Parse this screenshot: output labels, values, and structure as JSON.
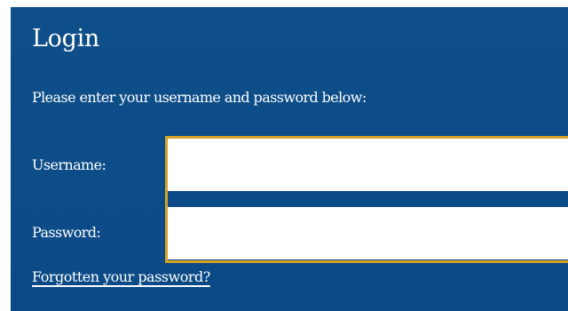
{
  "login": {
    "title": "Login",
    "instructions": "Please enter your username and password below:",
    "username_label": "Username:",
    "password_label": "Password:",
    "username_value": "",
    "password_value": "",
    "forgot_password_link": "Forgotten your password?"
  },
  "colors": {
    "panel_background": "#0b4a86",
    "input_focus_border": "#d6a227",
    "text": "#ffffff"
  }
}
